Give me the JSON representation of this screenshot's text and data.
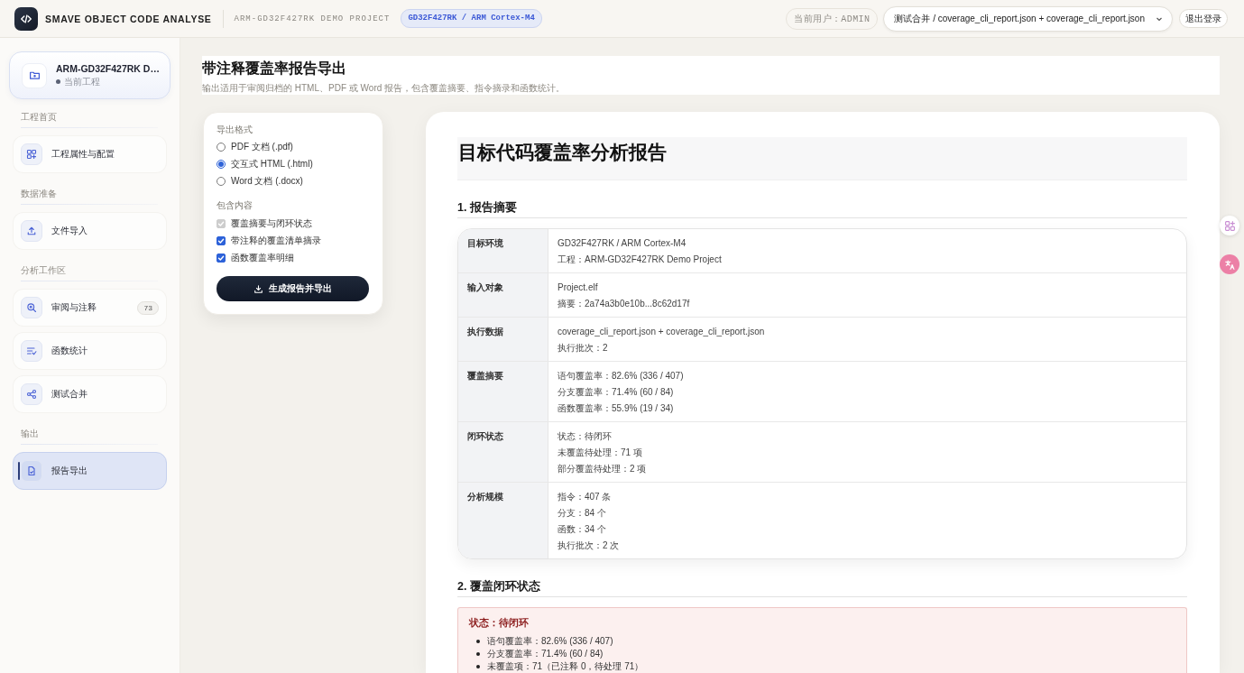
{
  "header": {
    "app_title": "SMAVE OBJECT CODE ANALYSE",
    "project": "ARM-GD32F427RK DEMO PROJECT",
    "target_badge": "GD32F427RK / ARM Cortex-M4",
    "user_badge": "当前用户：ADMIN",
    "dataset_select": {
      "value": "测试合并 / coverage_cli_report.json + coverage_cli_report.json"
    },
    "logout_button": "退出登录"
  },
  "sidebar": {
    "project_card": {
      "name": "ARM-GD32F427RK D…",
      "status": "当前工程"
    },
    "sections": [
      {
        "label": "工程首页",
        "items": [
          {
            "label": "工程属性与配置",
            "selected": false
          }
        ]
      },
      {
        "label": "数据准备",
        "items": [
          {
            "label": "文件导入",
            "selected": false
          }
        ]
      },
      {
        "label": "分析工作区",
        "items": [
          {
            "label": "审阅与注释",
            "badge": "73",
            "selected": false
          },
          {
            "label": "函数统计",
            "selected": false
          },
          {
            "label": "测试合并",
            "selected": false
          }
        ]
      },
      {
        "label": "输出",
        "items": [
          {
            "label": "报告导出",
            "selected": true
          }
        ]
      }
    ]
  },
  "page": {
    "title": "带注释覆盖率报告导出",
    "subtitle": "输出适用于审阅归档的 HTML、PDF 或 Word 报告，包含覆盖摘要、指令摘录和函数统计。"
  },
  "export_panel": {
    "format_label": "导出格式",
    "formats": [
      {
        "label": "PDF 文档 (.pdf)",
        "selected": false
      },
      {
        "label": "交互式 HTML (.html)",
        "selected": true
      },
      {
        "label": "Word 文档 (.docx)",
        "selected": false
      }
    ],
    "content_label": "包含内容",
    "contents": [
      {
        "label": "覆盖摘要与闭环状态",
        "checked": true,
        "disabled": true
      },
      {
        "label": "带注释的覆盖清单摘录",
        "checked": true,
        "disabled": false
      },
      {
        "label": "函数覆盖率明细",
        "checked": true,
        "disabled": false
      }
    ],
    "export_button": "生成报告并导出"
  },
  "report": {
    "title": "目标代码覆盖率分析报告",
    "sections": [
      {
        "kind": "table",
        "heading": "1. 报告摘要",
        "rows": [
          {
            "label": "目标环境",
            "lines": [
              "GD32F427RK / ARM Cortex-M4",
              "工程：ARM-GD32F427RK Demo Project"
            ]
          },
          {
            "label": "输入对象",
            "lines": [
              "Project.elf",
              "摘要：2a74a3b0e10b...8c62d17f"
            ]
          },
          {
            "label": "执行数据",
            "lines": [
              "coverage_cli_report.json + coverage_cli_report.json",
              "执行批次：2"
            ]
          },
          {
            "label": "覆盖摘要",
            "lines": [
              "语句覆盖率：82.6% (336 / 407)",
              "分支覆盖率：71.4% (60 / 84)",
              "函数覆盖率：55.9% (19 / 34)"
            ]
          },
          {
            "label": "闭环状态",
            "lines": [
              "状态：待闭环",
              "未覆盖待处理：71 项",
              "部分覆盖待处理：2 项"
            ]
          },
          {
            "label": "分析规模",
            "lines": [
              "指令：407 条",
              "分支：84 个",
              "函数：34 个",
              "执行批次：2 次"
            ]
          }
        ]
      },
      {
        "kind": "alert",
        "heading": "2. 覆盖闭环状态",
        "status": "状态：待闭环",
        "items": [
          "语句覆盖率：82.6% (336 / 407)",
          "分支覆盖率：71.4% (60 / 84)",
          "未覆盖项：71（已注释 0，待处理 71）"
        ]
      }
    ]
  }
}
